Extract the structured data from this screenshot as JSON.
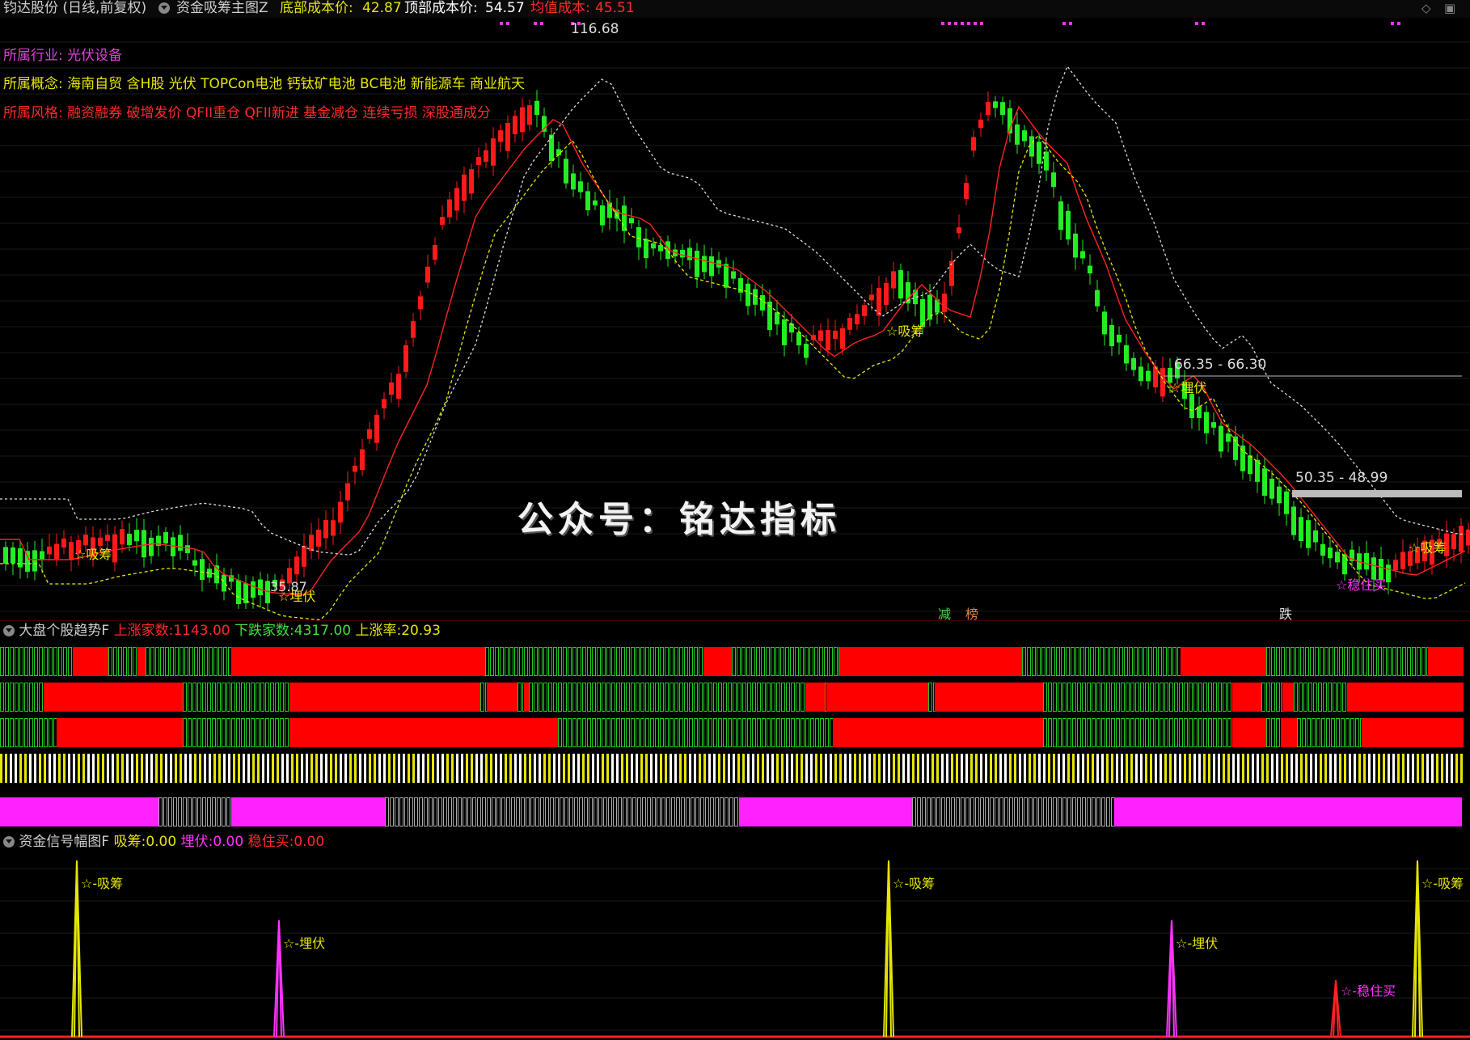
{
  "header": {
    "stock_title": "钧达股份 (日线,前复权)",
    "indicator_name": "资金吸筹主图Z",
    "bottom_cost_label": "底部成本价:",
    "bottom_cost_value": "42.87",
    "top_cost_label": "顶部成本价:",
    "top_cost_value": "54.57",
    "avg_cost_label": "均值成本:",
    "avg_cost_value": "45.51",
    "colors": {
      "bottom": "#e6e600",
      "top": "#ffffff",
      "avg": "#ff2a2a"
    }
  },
  "info": {
    "industry_label": "所属行业:",
    "industry_value": "光伏设备",
    "concept_label": "所属概念:",
    "concept_value": "海南自贸 含H股 光伏 TOPCon电池 钙钛矿电池 BC电池 新能源车 商业航天",
    "style_label": "所属风格:",
    "style_value": "融资融券 破增发价 QFII重仓 QFII新进 基金减仓 连续亏损 深股通成分"
  },
  "main_chart": {
    "price_high_label": "116.68",
    "price_low_label": "35.87",
    "range1_label": "66.35 - 66.30",
    "range2_label": "50.35 - 48.99",
    "signals": [
      {
        "text": "☆吸筹",
        "color": "#e6e600"
      },
      {
        "text": "☆埋伏",
        "color": "#e6e600"
      },
      {
        "text": "☆吸筹",
        "color": "#e6e600"
      },
      {
        "text": "☆埋伏",
        "color": "#e6e600"
      },
      {
        "text": "☆吸筹",
        "color": "#e6e600"
      },
      {
        "text": "☆稳住买",
        "color": "#ff33ff"
      }
    ],
    "bottom_tags": [
      "减",
      "榜",
      "跌"
    ],
    "watermark": "公众号：铭达指标"
  },
  "trend_panel": {
    "name": "大盘个股趋势F",
    "up_label": "上涨家数:",
    "up_value": "1143.00",
    "down_label": "下跌家数:",
    "down_value": "4317.00",
    "rate_label": "上涨率:",
    "rate_value": "20.93"
  },
  "signal_panel": {
    "name": "资金信号幅图F",
    "absorb_label": "吸筹:",
    "absorb_value": "0.00",
    "ambush_label": "埋伏:",
    "ambush_value": "0.00",
    "steady_label": "稳住买:",
    "steady_value": "0.00",
    "peak_labels": [
      {
        "text": "☆-吸筹",
        "color": "#e6e600"
      },
      {
        "text": "☆-埋伏",
        "color": "#e6e600"
      },
      {
        "text": "☆-吸筹",
        "color": "#e6e600"
      },
      {
        "text": "☆-埋伏",
        "color": "#e6e600"
      },
      {
        "text": "☆-稳住买",
        "color": "#ff33ff"
      },
      {
        "text": "☆-吸筹",
        "color": "#e6e600"
      }
    ]
  }
}
